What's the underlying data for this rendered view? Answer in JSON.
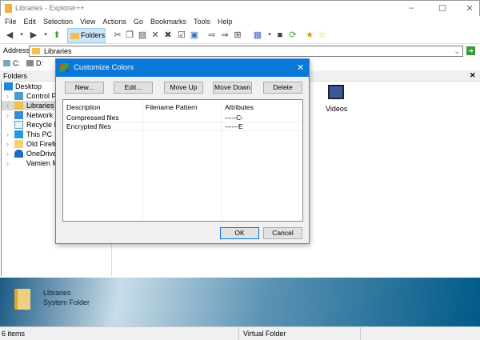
{
  "window": {
    "title": "Libraries - Explorer++"
  },
  "menu": [
    "File",
    "Edit",
    "Selection",
    "View",
    "Actions",
    "Go",
    "Bookmarks",
    "Tools",
    "Help"
  ],
  "toolbar": {
    "folders_label": "Folders"
  },
  "address": {
    "label": "Address",
    "value": "Libraries"
  },
  "drives": [
    "C:",
    "D:"
  ],
  "folders_pane": {
    "title": "Folders",
    "items": [
      "Desktop",
      "Control Panel",
      "Libraries",
      "Network",
      "Recycle Bin",
      "This PC",
      "Old Firefox Data",
      "OneDrive",
      "Vamien McKalin"
    ]
  },
  "content": {
    "items": [
      "Videos"
    ]
  },
  "info": {
    "name": "Libraries",
    "type": "System Folder"
  },
  "status": {
    "count": "6 items",
    "type": "Virtual Folder"
  },
  "dialog": {
    "title": "Customize Colors",
    "buttons": {
      "new": "New...",
      "edit": "Edit...",
      "move_up": "Move Up",
      "move_down": "Move Down",
      "delete": "Delete",
      "ok": "OK",
      "cancel": "Cancel"
    },
    "columns": [
      "Description",
      "Filename Pattern",
      "Attributes"
    ],
    "rows": [
      {
        "description": "Compressed files",
        "pattern": "",
        "attributes": "-----C-"
      },
      {
        "description": "Encrypted files",
        "pattern": "",
        "attributes": "------E"
      }
    ]
  },
  "colors": {
    "accent": "#0a78d7"
  }
}
